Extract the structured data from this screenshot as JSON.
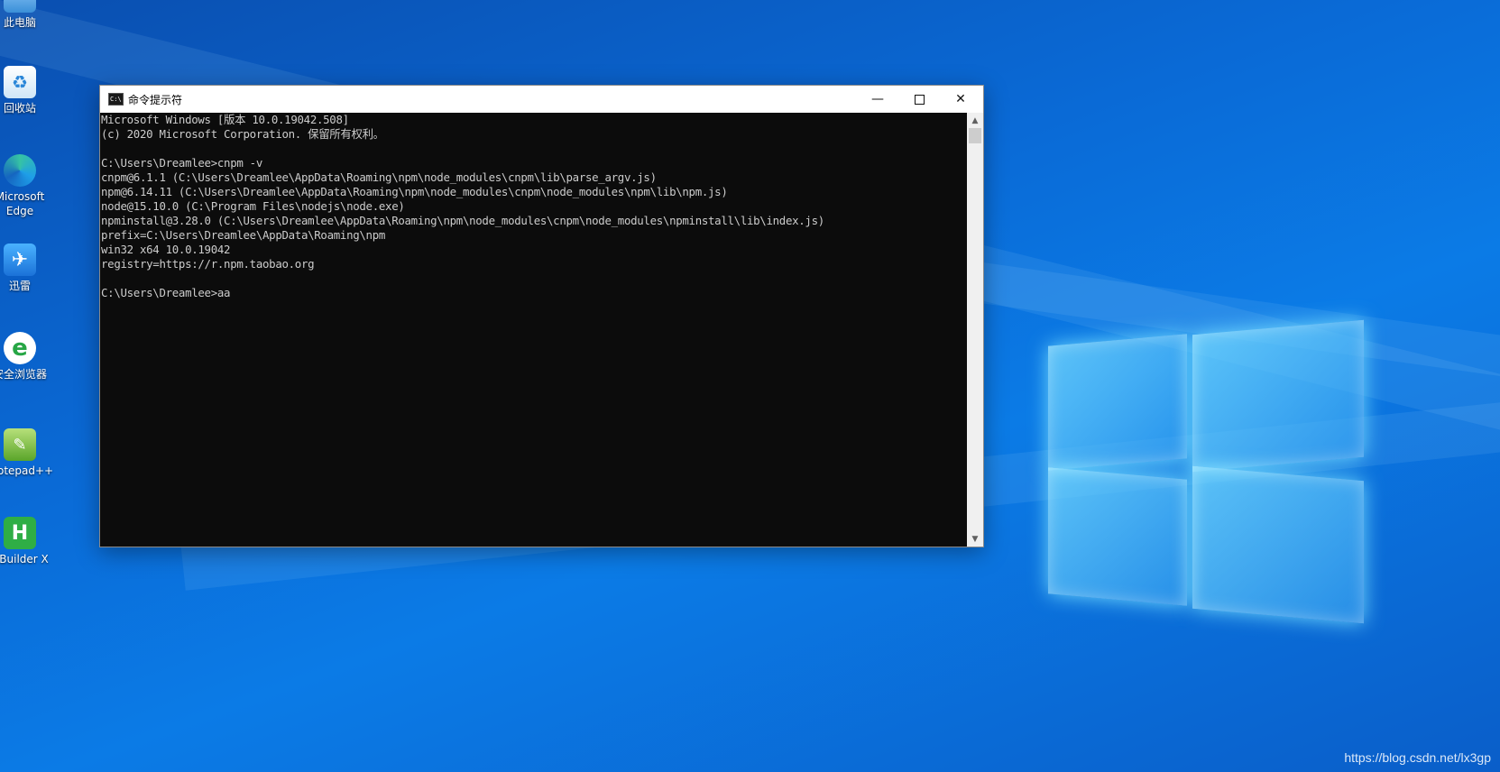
{
  "window": {
    "title": "命令提示符",
    "icon": "console-icon",
    "icon_text": "C:\\",
    "controls": {
      "minimize": "—",
      "close": "✕"
    }
  },
  "console": {
    "lines": [
      "Microsoft Windows [版本 10.0.19042.508]",
      "(c) 2020 Microsoft Corporation. 保留所有权利。",
      "",
      "C:\\Users\\Dreamlee>cnpm -v",
      "cnpm@6.1.1 (C:\\Users\\Dreamlee\\AppData\\Roaming\\npm\\node_modules\\cnpm\\lib\\parse_argv.js)",
      "npm@6.14.11 (C:\\Users\\Dreamlee\\AppData\\Roaming\\npm\\node_modules\\cnpm\\node_modules\\npm\\lib\\npm.js)",
      "node@15.10.0 (C:\\Program Files\\nodejs\\node.exe)",
      "npminstall@3.28.0 (C:\\Users\\Dreamlee\\AppData\\Roaming\\npm\\node_modules\\cnpm\\node_modules\\npminstall\\lib\\index.js)",
      "prefix=C:\\Users\\Dreamlee\\AppData\\Roaming\\npm",
      "win32 x64 10.0.19042",
      "registry=https://r.npm.taobao.org",
      "",
      "C:\\Users\\Dreamlee>aa"
    ]
  },
  "desktop": {
    "icons": [
      {
        "label": "此电脑",
        "icon": "computer-icon"
      },
      {
        "label": "回收站",
        "icon": "recycle-bin-icon"
      },
      {
        "label": "Microsoft Edge",
        "icon": "edge-icon"
      },
      {
        "label": "迅雷",
        "icon": "thunder-icon"
      },
      {
        "label": "安全浏览器",
        "icon": "browser-icon"
      },
      {
        "label": "Notepad++",
        "icon": "notepad-plus-plus-icon"
      },
      {
        "label": "HBuilder X",
        "icon": "hbuilder-icon",
        "glyph": "H"
      }
    ]
  },
  "watermark": "https://blog.csdn.net/lx3gp",
  "colors": {
    "console_bg": "#0c0c0c",
    "console_text": "#cccccc",
    "desktop_blue": "#0a6ad6"
  }
}
